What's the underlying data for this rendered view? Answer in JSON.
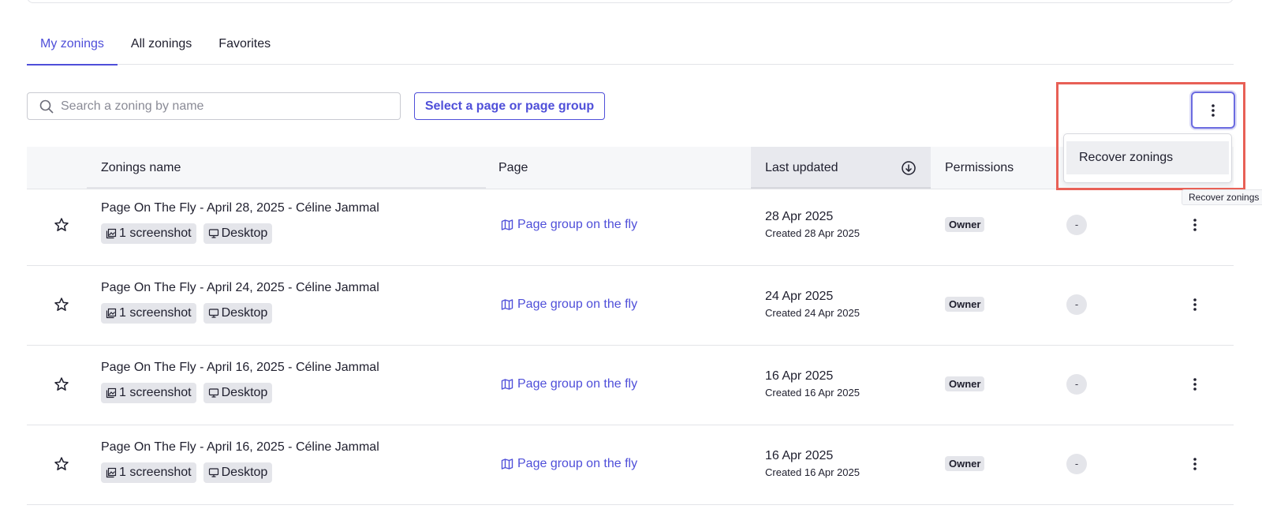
{
  "tabs": [
    {
      "label": "My zonings",
      "active": true
    },
    {
      "label": "All zonings",
      "active": false
    },
    {
      "label": "Favorites",
      "active": false
    }
  ],
  "search": {
    "placeholder": "Search a zoning by name",
    "value": ""
  },
  "select_page_button": "Select a page or page group",
  "table": {
    "headers": {
      "name": "Zonings name",
      "page": "Page",
      "last_updated": "Last updated",
      "permissions": "Permissions"
    },
    "rows": [
      {
        "name": "Page On The Fly - April 28, 2025 - Céline Jammal",
        "screenshot_tag": "1 screenshot",
        "device_tag": "Desktop",
        "page": "Page group on the fly",
        "updated": "28 Apr 2025",
        "created": "Created 28 Apr 2025",
        "permission": "Owner",
        "extra": "-"
      },
      {
        "name": "Page On The Fly - April 24, 2025 - Céline Jammal",
        "screenshot_tag": "1 screenshot",
        "device_tag": "Desktop",
        "page": "Page group on the fly",
        "updated": "24 Apr 2025",
        "created": "Created 24 Apr 2025",
        "permission": "Owner",
        "extra": "-"
      },
      {
        "name": "Page On The Fly - April 16, 2025 - Céline Jammal",
        "screenshot_tag": "1 screenshot",
        "device_tag": "Desktop",
        "page": "Page group on the fly",
        "updated": "16 Apr 2025",
        "created": "Created 16 Apr 2025",
        "permission": "Owner",
        "extra": "-"
      },
      {
        "name": "Page On The Fly - April 16, 2025 - Céline Jammal",
        "screenshot_tag": "1 screenshot",
        "device_tag": "Desktop",
        "page": "Page group on the fly",
        "updated": "16 Apr 2025",
        "created": "Created 16 Apr 2025",
        "permission": "Owner",
        "extra": "-"
      }
    ]
  },
  "dropdown": {
    "item": "Recover zonings"
  },
  "tooltip": "Recover zonings",
  "colors": {
    "accent": "#4f4fd9",
    "highlight": "#e86056",
    "tag_bg": "#e4e5ea"
  }
}
